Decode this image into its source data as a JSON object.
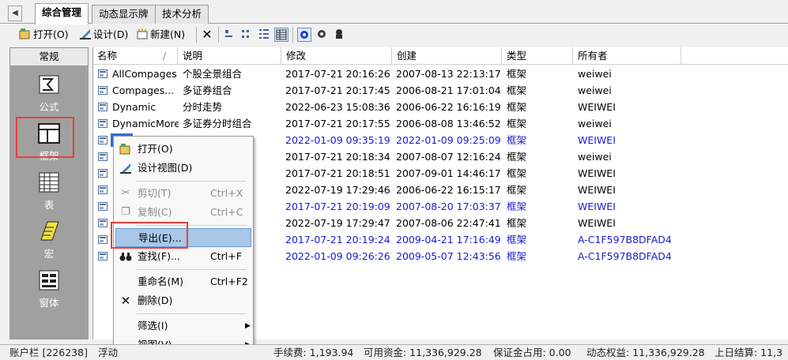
{
  "tabs": [
    "综合管理",
    "动态显示牌",
    "技术分析"
  ],
  "toolbar": {
    "open": "打开(O)",
    "design": "设计(D)",
    "new": "新建(N)"
  },
  "leftpanel": {
    "title": "常规",
    "items": [
      "公式",
      "框架",
      "表",
      "宏",
      "窗体"
    ]
  },
  "columns": [
    "名称",
    "说明",
    "修改",
    "创建",
    "类型",
    "所有者"
  ],
  "rows": [
    {
      "name": "AllCompages",
      "desc": "个股全景组合",
      "modified": "2017-07-21 20:16:26",
      "created": "2007-08-13 22:13:17",
      "type": "框架",
      "owner": "weiwei"
    },
    {
      "name": "Compages...",
      "desc": "多证券组合",
      "modified": "2017-07-21 20:17:45",
      "created": "2006-08-21 17:01:04",
      "type": "框架",
      "owner": "weiwei"
    },
    {
      "name": "Dynamic",
      "desc": "分时走势",
      "modified": "2022-06-23 15:08:36",
      "created": "2006-06-22 16:16:19",
      "type": "框架",
      "owner": "WEIWEI"
    },
    {
      "name": "DynamicMore",
      "desc": "多证券分时组合",
      "modified": "2017-07-21 20:17:55",
      "created": "2006-08-08 13:46:52",
      "type": "框架",
      "owner": "weiwei"
    },
    {
      "name": "",
      "desc": "",
      "modified": "2022-01-09 09:35:19",
      "created": "2022-01-09 09:25:09",
      "type": "框架",
      "owner": "WEIWEI"
    },
    {
      "name": "",
      "desc": "",
      "modified": "2017-07-21 20:18:34",
      "created": "2007-08-07 12:16:24",
      "type": "框架",
      "owner": "weiwei"
    },
    {
      "name": "",
      "desc": "",
      "modified": "2017-07-21 20:18:51",
      "created": "2007-09-01 14:46:17",
      "type": "框架",
      "owner": "WEIWEI"
    },
    {
      "name": "",
      "desc": "",
      "modified": "2022-07-19 17:29:46",
      "created": "2006-06-22 16:15:17",
      "type": "框架",
      "owner": "WEIWEI"
    },
    {
      "name": "",
      "desc": "",
      "modified": "2017-07-21 20:19:09",
      "created": "2007-08-20 17:03:37",
      "type": "框架",
      "owner": "WEIWEI"
    },
    {
      "name": "",
      "desc": "",
      "modified": "2022-07-19 17:29:47",
      "created": "2007-08-06 22:47:41",
      "type": "框架",
      "owner": "WEIWEI"
    },
    {
      "name": "",
      "desc": "",
      "modified": "2017-07-21 20:19:24",
      "created": "2009-04-21 17:16:49",
      "type": "框架",
      "owner": "A-C1F597B8DFAD4"
    },
    {
      "name": "",
      "desc": "",
      "modified": "2022-01-09 09:26:26",
      "created": "2009-05-07 12:43:56",
      "type": "框架",
      "owner": "A-C1F597B8DFAD4"
    }
  ],
  "menu": {
    "open": "打开(O)",
    "design_view": "设计视图(D)",
    "cut": "剪切(T)",
    "cut_key": "Ctrl+X",
    "copy": "复制(C)",
    "copy_key": "Ctrl+C",
    "export": "导出(E)...",
    "find": "查找(F)...",
    "find_key": "Ctrl+F",
    "rename": "重命名(M)",
    "rename_key": "Ctrl+F2",
    "delete": "删除(D)",
    "filter": "筛选(I)",
    "view": "视图(V)"
  },
  "status": {
    "account": "账户栏 [226238]",
    "float": "浮动",
    "fee": "手续费: 1,193.94",
    "avail": "可用资金: 11,336,929.28",
    "margin": "保证金占用: 0.00",
    "equity": "动态权益: 11,336,929.28",
    "prev": "上日结算: 11,3"
  },
  "colors": {
    "highlight": "#a9c7e8",
    "blue_text": "#1a1ad0",
    "red_box": "#e64040",
    "panel": "#a0a0a0"
  }
}
